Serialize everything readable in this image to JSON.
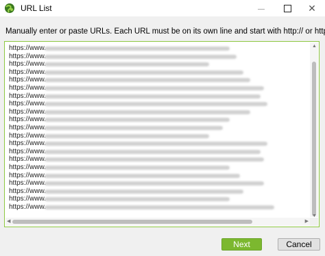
{
  "window": {
    "title": "URL List",
    "icon": "app-globe-icon",
    "controls": [
      "minimize-icon",
      "maximize-icon",
      "close-icon"
    ],
    "close_glyph": "✕"
  },
  "instruction": "Manually enter or paste URLs. Each URL must be on its own line and start with http:// or https://",
  "url_list": {
    "visible_prefix": "https://www.",
    "line_count": 21,
    "lines": [
      "https://www.",
      "https://www.",
      "https://www.",
      "https://www.",
      "https://www.",
      "https://www.",
      "https://www.",
      "https://www.",
      "https://www.",
      "https://www.",
      "https://www.",
      "https://www.",
      "https://www.",
      "https://www.",
      "https://www.",
      "https://www.",
      "https://www.",
      "https://www.",
      "https://www.",
      "https://www.",
      "https://www."
    ]
  },
  "buttons": {
    "next": "Next",
    "cancel": "Cancel"
  },
  "colors": {
    "accent": "#7cb82f",
    "border_focus": "#8cc63f"
  }
}
